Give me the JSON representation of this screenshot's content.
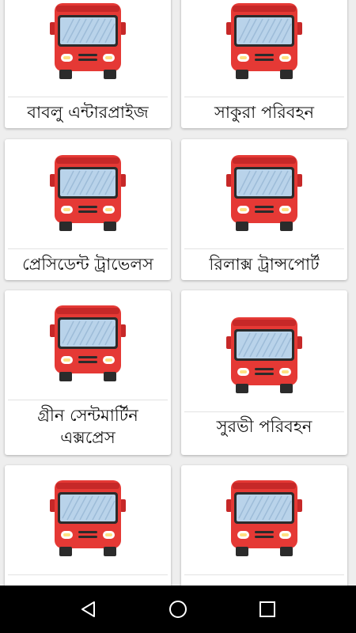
{
  "cards": [
    {
      "label": "বাবলু এন্টারপ্রাইজ",
      "icon": "bus-icon"
    },
    {
      "label": "সাকুরা পরিবহন",
      "icon": "bus-icon"
    },
    {
      "label": "প্রেসিডেন্ট ট্রাভেলস",
      "icon": "bus-icon"
    },
    {
      "label": "রিলাক্স ট্রান্সপোর্ট",
      "icon": "bus-icon"
    },
    {
      "label_line1": "গ্রীন সেন্টমার্টিন",
      "label_line2": "এক্সপ্রেস",
      "icon": "bus-icon"
    },
    {
      "label": "সুরভী পরিবহন",
      "icon": "bus-icon"
    }
  ],
  "navbar": {
    "back": "back-icon",
    "home": "home-icon",
    "recents": "recents-icon"
  },
  "colors": {
    "bus_red": "#e53935",
    "bus_dark": "#2b2b2b",
    "window": "#b9d3ea",
    "card_bg": "#ffffff",
    "page_bg": "#eeeeee"
  }
}
